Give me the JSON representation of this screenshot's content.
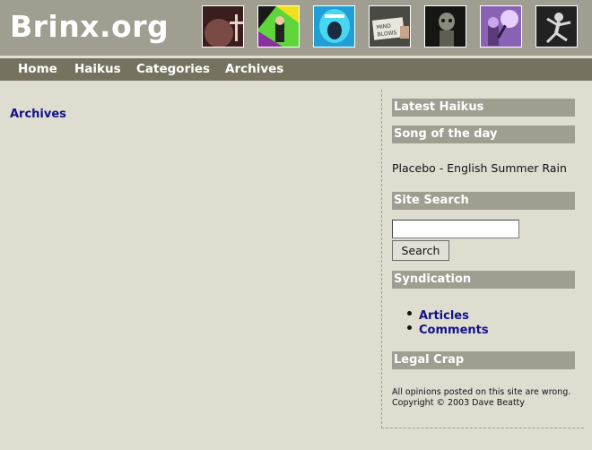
{
  "header": {
    "site_title": "Brinx.org",
    "thumbnails": [
      {
        "name": "thumb-cross-icon",
        "bg": "#3a1e1e",
        "fg": "#e5d3c8"
      },
      {
        "name": "thumb-colorful-figure-icon",
        "bg": "#5ed639",
        "fg": "#f0df1e"
      },
      {
        "name": "thumb-screaming-face-icon",
        "bg": "#1f9fd6",
        "fg": "#1a2b40"
      },
      {
        "name": "thumb-sign-icon",
        "bg": "#4a4a45",
        "fg": "#e9e6dc"
      },
      {
        "name": "thumb-skull-figure-icon",
        "bg": "#151512",
        "fg": "#8a8a80"
      },
      {
        "name": "thumb-purple-microphone-icon",
        "bg": "#8a62b5",
        "fg": "#e6cfff"
      },
      {
        "name": "thumb-jumping-person-icon",
        "bg": "#222222",
        "fg": "#d8d8d8"
      }
    ]
  },
  "nav": {
    "items": [
      "Home",
      "Haikus",
      "Categories",
      "Archives"
    ]
  },
  "main": {
    "archives_link": "Archives"
  },
  "sidebar": {
    "latest_haikus_heading": "Latest Haikus",
    "song_heading": "Song of the day",
    "song_text": "Placebo - English Summer Rain",
    "search_heading": "Site Search",
    "search_value": "",
    "search_button_label": "Search",
    "syndication_heading": "Syndication",
    "syndication_links": [
      "Articles",
      "Comments"
    ],
    "legal_heading": "Legal Crap",
    "legal_line1": "All opinions posted on this site are wrong.",
    "legal_line2": "Copyright © 2003 Dave Beatty"
  },
  "colors": {
    "header_bg": "#a09e90",
    "nav_bg": "#75735f",
    "page_bg": "#dfddd0",
    "link": "#12128a"
  }
}
